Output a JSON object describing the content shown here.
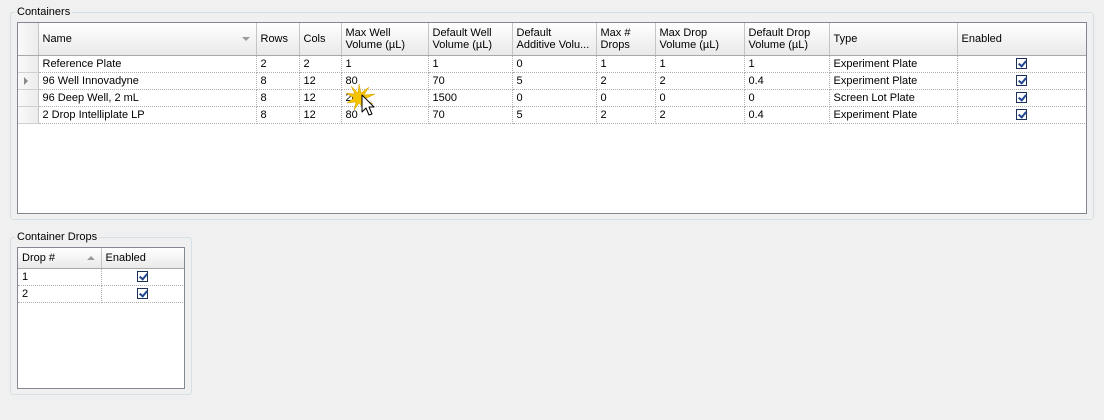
{
  "containers": {
    "title": "Containers",
    "columns": [
      {
        "key": "name",
        "label": "Name"
      },
      {
        "key": "rows",
        "label": "Rows"
      },
      {
        "key": "cols",
        "label": "Cols"
      },
      {
        "key": "max_well_volume",
        "label": "Max Well\nVolume (µL)"
      },
      {
        "key": "default_well_volume",
        "label": "Default Well\nVolume (µL)"
      },
      {
        "key": "default_additive_volume",
        "label": "Default\nAdditive Volu..."
      },
      {
        "key": "max_drops",
        "label": "Max #\nDrops"
      },
      {
        "key": "max_drop_volume",
        "label": "Max Drop\nVolume (µL)"
      },
      {
        "key": "default_drop_volume",
        "label": "Default Drop\nVolume (µL)"
      },
      {
        "key": "type",
        "label": "Type"
      },
      {
        "key": "enabled",
        "label": "Enabled"
      }
    ],
    "rows": [
      {
        "name": "Reference Plate",
        "rows": "2",
        "cols": "2",
        "max_well_volume": "1",
        "default_well_volume": "1",
        "default_additive_volume": "0",
        "max_drops": "1",
        "max_drop_volume": "1",
        "default_drop_volume": "1",
        "type": "Experiment Plate",
        "enabled": true,
        "current": false
      },
      {
        "name": "96 Well Innovadyne",
        "rows": "8",
        "cols": "12",
        "max_well_volume": "80",
        "default_well_volume": "70",
        "default_additive_volume": "5",
        "max_drops": "2",
        "max_drop_volume": "2",
        "default_drop_volume": "0.4",
        "type": "Experiment Plate",
        "enabled": true,
        "current": true
      },
      {
        "name": "96 Deep Well, 2 mL",
        "rows": "8",
        "cols": "12",
        "max_well_volume": "20",
        "default_well_volume": "1500",
        "default_additive_volume": "0",
        "max_drops": "0",
        "max_drop_volume": "0",
        "default_drop_volume": "0",
        "type": "Screen Lot Plate",
        "enabled": true,
        "current": false
      },
      {
        "name": "2 Drop Intelliplate LP",
        "rows": "8",
        "cols": "12",
        "max_well_volume": "80",
        "default_well_volume": "70",
        "default_additive_volume": "5",
        "max_drops": "2",
        "max_drop_volume": "2",
        "default_drop_volume": "0.4",
        "type": "Experiment Plate",
        "enabled": true,
        "current": false
      }
    ]
  },
  "container_drops": {
    "title": "Container Drops",
    "columns": [
      {
        "key": "drop",
        "label": "Drop #"
      },
      {
        "key": "enabled",
        "label": "Enabled"
      }
    ],
    "rows": [
      {
        "drop": "1",
        "enabled": true
      },
      {
        "drop": "2",
        "enabled": true
      }
    ]
  },
  "icons": {
    "sort_indicator": "sort-descending-icon",
    "row_pointer": "current-row-arrow-icon",
    "cursor": "mouse-pointer-icon",
    "click_burst": "click-burst-icon"
  },
  "colors": {
    "grid_border": "#828790",
    "check_mark": "#21468f",
    "click_burst": "#f5c400"
  }
}
